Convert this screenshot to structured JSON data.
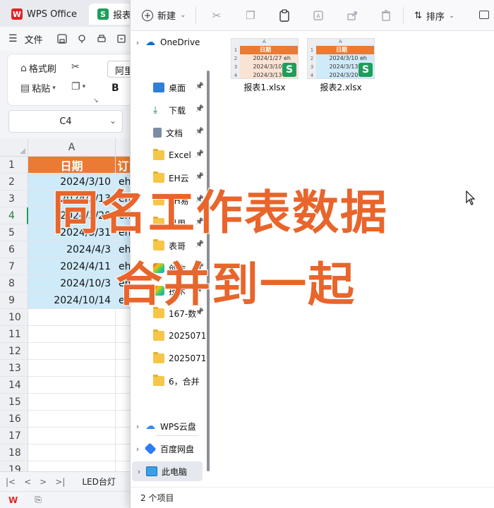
{
  "wps": {
    "tabs": [
      {
        "label": "WPS Office",
        "logo": "W"
      },
      {
        "label": "报表",
        "logo": "S"
      }
    ],
    "menu": {
      "file_label": "文件"
    },
    "ribbon": {
      "format_painter": "格式刷",
      "paste": "粘贴",
      "font_name": "阿里",
      "bold": "B"
    },
    "name_box": "C4",
    "columns": [
      "A"
    ],
    "header_cell": "日期",
    "header_cell_partial": "订",
    "rows": [
      {
        "num": "1",
        "date": "",
        "extra": ""
      },
      {
        "num": "2",
        "date": "2024/3/10",
        "extra": "eh"
      },
      {
        "num": "3",
        "date": "2024/3/13",
        "extra": "eh"
      },
      {
        "num": "4",
        "date": "2024/3/20",
        "extra": "eh"
      },
      {
        "num": "5",
        "date": "2024/3/31",
        "extra": "eh"
      },
      {
        "num": "6",
        "date": "2024/4/3",
        "extra": "eh"
      },
      {
        "num": "7",
        "date": "2024/4/11",
        "extra": "eh"
      },
      {
        "num": "8",
        "date": "2024/10/3",
        "extra": "eh"
      },
      {
        "num": "9",
        "date": "2024/10/14",
        "extra": "eh"
      },
      {
        "num": "10",
        "date": "",
        "extra": ""
      },
      {
        "num": "11",
        "date": "",
        "extra": ""
      },
      {
        "num": "12",
        "date": "",
        "extra": ""
      },
      {
        "num": "13",
        "date": "",
        "extra": ""
      },
      {
        "num": "14",
        "date": "",
        "extra": ""
      },
      {
        "num": "15",
        "date": "",
        "extra": ""
      },
      {
        "num": "16",
        "date": "",
        "extra": ""
      },
      {
        "num": "17",
        "date": "",
        "extra": ""
      },
      {
        "num": "18",
        "date": "",
        "extra": ""
      },
      {
        "num": "19",
        "date": "",
        "extra": ""
      }
    ],
    "sheet_tab": "LED台灯",
    "colors": {
      "header_orange": "#ea7a34",
      "selection_blue": "#cfeaf8",
      "wps_red": "#e02424",
      "sheet_green": "#1e9e5b"
    }
  },
  "explorer": {
    "toolbar": {
      "new_label": "新建",
      "sort_label": "排序"
    },
    "nav": [
      {
        "label": "OneDrive",
        "icon": "cloud-icon",
        "expandable": true,
        "pinned": false
      },
      {
        "label": "桌面",
        "icon": "desktop-icon",
        "expandable": false,
        "pinned": true
      },
      {
        "label": "下载",
        "icon": "download-icon",
        "expandable": false,
        "pinned": true
      },
      {
        "label": "文档",
        "icon": "document-icon",
        "expandable": false,
        "pinned": true
      },
      {
        "label": "Excel",
        "icon": "folder-icon",
        "expandable": false,
        "pinned": true
      },
      {
        "label": "EH云",
        "icon": "folder-icon",
        "expandable": false,
        "pinned": true
      },
      {
        "label": "EH易",
        "icon": "folder-icon",
        "expandable": false,
        "pinned": true
      },
      {
        "label": "易用",
        "icon": "folder-icon",
        "expandable": false,
        "pinned": true
      },
      {
        "label": "表哥",
        "icon": "folder-icon",
        "expandable": false,
        "pinned": true
      },
      {
        "label": "创作",
        "icon": "app-icon",
        "expandable": false,
        "pinned": true
      },
      {
        "label": "技术",
        "icon": "app-icon",
        "expandable": false,
        "pinned": true
      },
      {
        "label": "167-数",
        "icon": "folder-icon",
        "expandable": false,
        "pinned": true
      },
      {
        "label": "2025071",
        "icon": "folder-icon",
        "expandable": false,
        "pinned": false
      },
      {
        "label": "2025071",
        "icon": "folder-icon",
        "expandable": false,
        "pinned": false
      },
      {
        "label": "6，合并",
        "icon": "folder-icon",
        "expandable": false,
        "pinned": false
      },
      {
        "label": "WPS云盘",
        "icon": "cloud-icon",
        "expandable": true,
        "pinned": false
      },
      {
        "label": "百度网盘",
        "icon": "baidu-icon",
        "expandable": true,
        "pinned": false
      },
      {
        "label": "此电脑",
        "icon": "computer-icon",
        "expandable": true,
        "pinned": false
      }
    ],
    "files": [
      {
        "name": "报表1.xlsx",
        "header": "日期",
        "rows": [
          "2024/1/27 eh",
          "2024/3/10 eh",
          "2024/3/13 eh"
        ],
        "row_color": "#fbe3d4"
      },
      {
        "name": "报表2.xlsx",
        "header": "日期",
        "rows": [
          "2024/3/10 eh",
          "2024/3/13 eh",
          "2024/3/20 eh"
        ],
        "row_color": "#cfeaf8"
      }
    ],
    "thumb_col_label": "A",
    "status": "2 个项目"
  },
  "overlay": {
    "line1": "同名工作表数据",
    "line2": "合并到一起",
    "color": "#e8652b"
  }
}
